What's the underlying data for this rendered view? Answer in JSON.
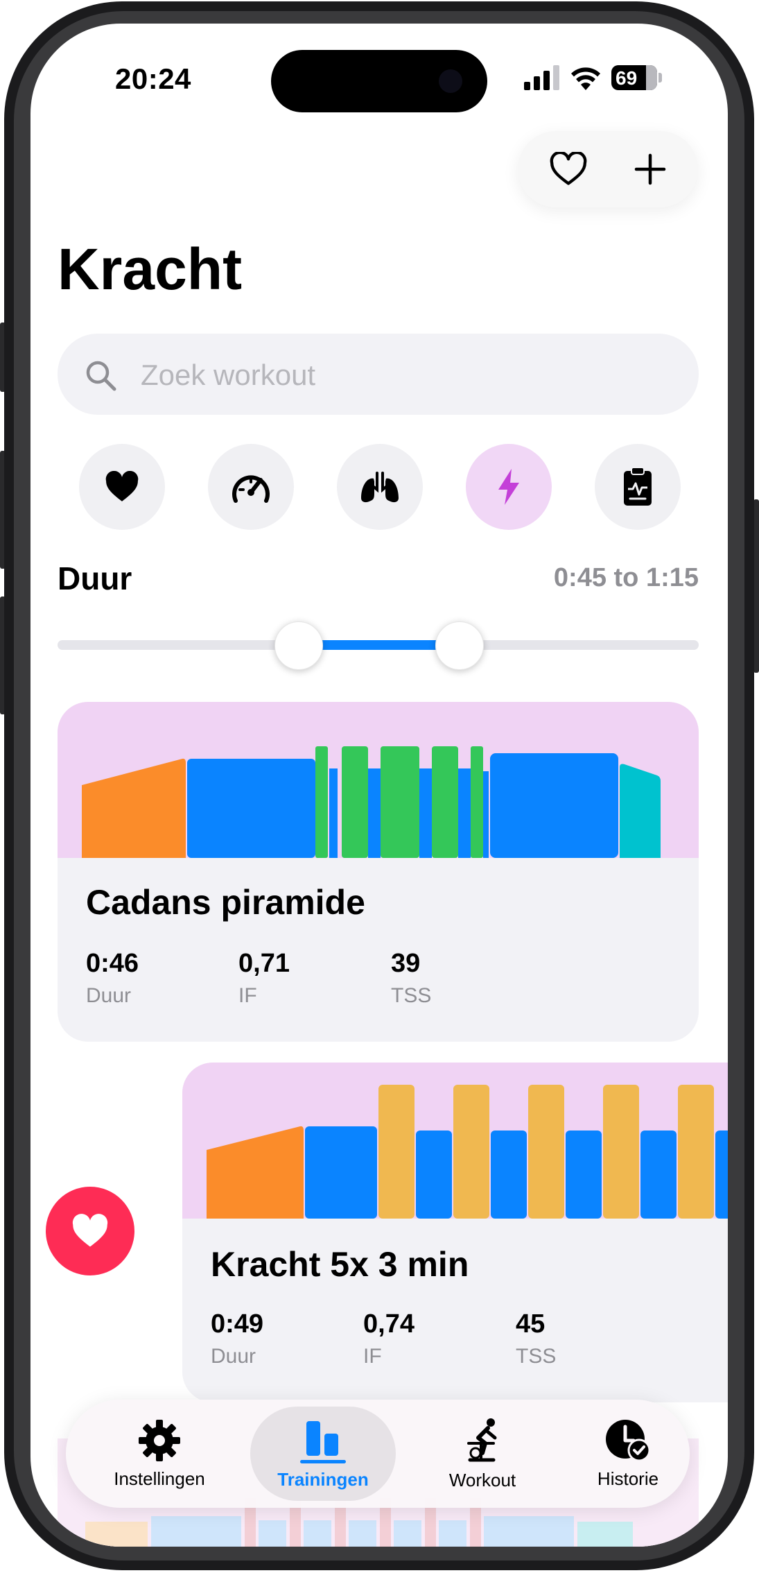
{
  "status_bar": {
    "time": "20:24",
    "battery": "69"
  },
  "header": {
    "title": "Kracht",
    "favorite_icon": "heart-outline-icon",
    "add_icon": "plus-icon"
  },
  "search": {
    "placeholder": "Zoek workout",
    "value": ""
  },
  "categories": [
    {
      "icon": "heart-icon",
      "active": false
    },
    {
      "icon": "speedometer-icon",
      "active": false
    },
    {
      "icon": "lungs-icon",
      "active": false
    },
    {
      "icon": "lightning-icon",
      "active": true
    },
    {
      "icon": "clipboard-pulse-icon",
      "active": false
    }
  ],
  "duration_filter": {
    "label": "Duur",
    "range_text": "0:45 to 1:15",
    "min": "0:45",
    "max": "1:15"
  },
  "workouts": [
    {
      "name": "Cadans piramide",
      "stats": [
        {
          "value": "0:46",
          "label": "Duur"
        },
        {
          "value": "0,71",
          "label": "IF"
        },
        {
          "value": "39",
          "label": "TSS"
        }
      ]
    },
    {
      "name": "Kracht 5x 3 min",
      "stats": [
        {
          "value": "0:49",
          "label": "Duur"
        },
        {
          "value": "0,74",
          "label": "IF"
        },
        {
          "value": "45",
          "label": "TSS"
        }
      ],
      "favorite_action_icon": "heart-icon"
    }
  ],
  "tab_bar": {
    "items": [
      {
        "label": "Instellingen",
        "icon": "gear-icon",
        "active": false
      },
      {
        "label": "Trainingen",
        "icon": "bar-chart-icon",
        "active": true
      },
      {
        "label": "Workout",
        "icon": "cyclist-icon",
        "active": false
      },
      {
        "label": "Historie",
        "icon": "clock-check-icon",
        "active": false
      }
    ]
  },
  "colors": {
    "accent": "#0a84ff",
    "chart_background": "#f0d3f4",
    "warmup": "#fb8c2a",
    "endurance": "#0a84ff",
    "cadence": "#34c759",
    "power": "#f0b850",
    "cooldown": "#00c2cf",
    "favorite": "#fe2c55",
    "active_category": "#f1d7f6"
  }
}
